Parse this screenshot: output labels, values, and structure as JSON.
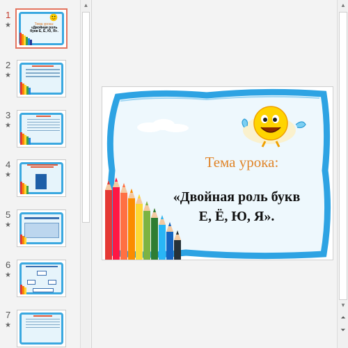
{
  "thumbnails": [
    {
      "number": "1",
      "title": "Тема урока:",
      "subtitle": "«Двойная роль букв Е, Ё, Ю, Я».",
      "active": true
    },
    {
      "number": "2",
      "title": "",
      "subtitle": "",
      "active": false
    },
    {
      "number": "3",
      "title": "",
      "subtitle": "",
      "active": false
    },
    {
      "number": "4",
      "title": "",
      "subtitle": "",
      "active": false
    },
    {
      "number": "5",
      "title": "",
      "subtitle": "",
      "active": false
    },
    {
      "number": "6",
      "title": "",
      "subtitle": "",
      "active": false
    },
    {
      "number": "7",
      "title": "",
      "subtitle": "",
      "active": false
    }
  ],
  "slide": {
    "title": "Тема урока:",
    "subtitle_line1": "«Двойная роль букв",
    "subtitle_line2": "Е, Ё, Ю, Я»."
  },
  "icons": {
    "animation": "star-icon",
    "scroll_up": "triangle-up-icon",
    "scroll_down": "triangle-down-icon",
    "prev_slide": "double-chevron-up-icon",
    "next_slide": "double-chevron-down-icon"
  },
  "colors": {
    "frame": "#3aa8e0",
    "title": "#e0852a",
    "active_thumb_border": "#e3735e",
    "active_number": "#c0392b"
  }
}
